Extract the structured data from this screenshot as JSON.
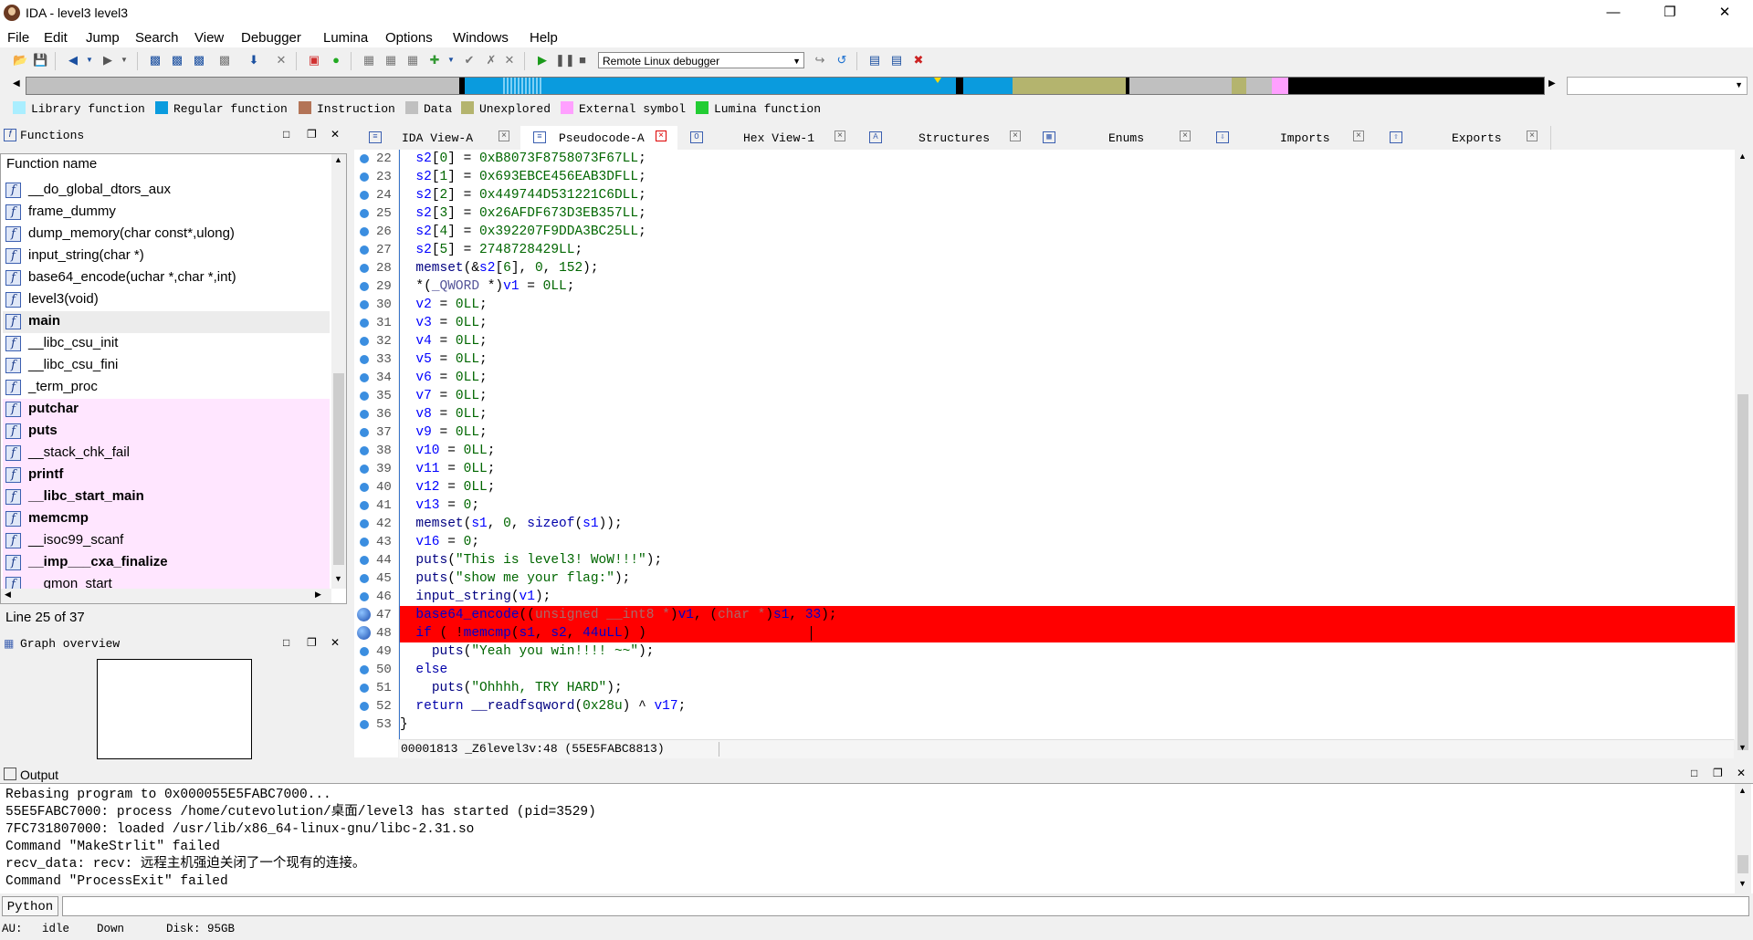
{
  "window": {
    "title": "IDA - level3 level3"
  },
  "menu": [
    "File",
    "Edit",
    "Jump",
    "Search",
    "View",
    "Debugger",
    "Lumina",
    "Options",
    "Windows",
    "Help"
  ],
  "toolbar": {
    "debugger": "Remote Linux debugger"
  },
  "legend": [
    {
      "label": "Library function",
      "color": "#aaeeff"
    },
    {
      "label": "Regular function",
      "color": "#0a9bde"
    },
    {
      "label": "Instruction",
      "color": "#b37457"
    },
    {
      "label": "Data",
      "color": "#c0c0c0"
    },
    {
      "label": "Unexplored",
      "color": "#b4b46e"
    },
    {
      "label": "External symbol",
      "color": "#ffa0ff"
    },
    {
      "label": "Lumina function",
      "color": "#22cc33"
    }
  ],
  "functions_panel": {
    "title": "Functions",
    "column_header": "Function name",
    "items": [
      {
        "name": "__do_global_dtors_aux",
        "bold": false,
        "external": false
      },
      {
        "name": "frame_dummy",
        "bold": false,
        "external": false
      },
      {
        "name": "dump_memory(char const*,ulong)",
        "bold": false,
        "external": false
      },
      {
        "name": "input_string(char *)",
        "bold": false,
        "external": false
      },
      {
        "name": "base64_encode(uchar *,char *,int)",
        "bold": false,
        "external": false
      },
      {
        "name": "level3(void)",
        "bold": false,
        "external": false
      },
      {
        "name": "main",
        "bold": true,
        "external": false
      },
      {
        "name": "__libc_csu_init",
        "bold": false,
        "external": false
      },
      {
        "name": "__libc_csu_fini",
        "bold": false,
        "external": false
      },
      {
        "name": "_term_proc",
        "bold": false,
        "external": false
      },
      {
        "name": "putchar",
        "bold": true,
        "external": true
      },
      {
        "name": "puts",
        "bold": true,
        "external": true
      },
      {
        "name": "__stack_chk_fail",
        "bold": false,
        "external": true
      },
      {
        "name": "printf",
        "bold": true,
        "external": true
      },
      {
        "name": "__libc_start_main",
        "bold": true,
        "external": true
      },
      {
        "name": "memcmp",
        "bold": true,
        "external": true
      },
      {
        "name": "__isoc99_scanf",
        "bold": false,
        "external": true
      },
      {
        "name": "__imp___cxa_finalize",
        "bold": true,
        "external": true
      },
      {
        "name": "__gmon_start__",
        "bold": false,
        "external": true
      }
    ],
    "line_info": "Line 25 of 37"
  },
  "graph_panel": {
    "title": "Graph overview"
  },
  "tabs": [
    {
      "label": "IDA View-A",
      "active": false,
      "icon": "ida-view-icon"
    },
    {
      "label": "Pseudocode-A",
      "active": true,
      "icon": "pseudocode-icon"
    },
    {
      "label": "Hex View-1",
      "active": false,
      "icon": "hex-view-icon"
    },
    {
      "label": "Structures",
      "active": false,
      "icon": "structures-icon"
    },
    {
      "label": "Enums",
      "active": false,
      "icon": "enums-icon"
    },
    {
      "label": "Imports",
      "active": false,
      "icon": "imports-icon"
    },
    {
      "label": "Exports",
      "active": false,
      "icon": "exports-icon"
    }
  ],
  "code": [
    {
      "n": 22,
      "t": [
        [
          "  ",
          ""
        ],
        [
          "s2",
          "v"
        ],
        [
          "[",
          ""
        ],
        [
          "0",
          "n"
        ],
        [
          "] = ",
          ""
        ],
        [
          "0xB8073F8758073F67LL",
          "n"
        ],
        [
          ";",
          ""
        ]
      ]
    },
    {
      "n": 23,
      "t": [
        [
          "  ",
          ""
        ],
        [
          "s2",
          "v"
        ],
        [
          "[",
          ""
        ],
        [
          "1",
          "n"
        ],
        [
          "] = ",
          ""
        ],
        [
          "0x693EBCE456EAB3DFLL",
          "n"
        ],
        [
          ";",
          ""
        ]
      ]
    },
    {
      "n": 24,
      "t": [
        [
          "  ",
          ""
        ],
        [
          "s2",
          "v"
        ],
        [
          "[",
          ""
        ],
        [
          "2",
          "n"
        ],
        [
          "] = ",
          ""
        ],
        [
          "0x449744D531221C6DLL",
          "n"
        ],
        [
          ";",
          ""
        ]
      ]
    },
    {
      "n": 25,
      "t": [
        [
          "  ",
          ""
        ],
        [
          "s2",
          "v"
        ],
        [
          "[",
          ""
        ],
        [
          "3",
          "n"
        ],
        [
          "] = ",
          ""
        ],
        [
          "0x26AFDF673D3EB357LL",
          "n"
        ],
        [
          ";",
          ""
        ]
      ]
    },
    {
      "n": 26,
      "t": [
        [
          "  ",
          ""
        ],
        [
          "s2",
          "v"
        ],
        [
          "[",
          ""
        ],
        [
          "4",
          "n"
        ],
        [
          "] = ",
          ""
        ],
        [
          "0x392207F9DDA3BC25LL",
          "n"
        ],
        [
          ";",
          ""
        ]
      ]
    },
    {
      "n": 27,
      "t": [
        [
          "  ",
          ""
        ],
        [
          "s2",
          "v"
        ],
        [
          "[",
          ""
        ],
        [
          "5",
          "n"
        ],
        [
          "] = ",
          ""
        ],
        [
          "2748728429LL",
          "n"
        ],
        [
          ";",
          ""
        ]
      ]
    },
    {
      "n": 28,
      "t": [
        [
          "  ",
          ""
        ],
        [
          "memset",
          "p"
        ],
        [
          "(&",
          ""
        ],
        [
          "s2",
          "v"
        ],
        [
          "[",
          ""
        ],
        [
          "6",
          "n"
        ],
        [
          "], ",
          ""
        ],
        [
          "0",
          "n"
        ],
        [
          ", ",
          ""
        ],
        [
          "152",
          "n"
        ],
        [
          ");",
          ""
        ]
      ]
    },
    {
      "n": 29,
      "t": [
        [
          "  *(",
          ""
        ],
        [
          "_QWORD",
          "t"
        ],
        [
          " *)",
          ""
        ],
        [
          "v1",
          "v"
        ],
        [
          " = ",
          ""
        ],
        [
          "0LL",
          "n"
        ],
        [
          ";",
          ""
        ]
      ]
    },
    {
      "n": 30,
      "t": [
        [
          "  ",
          ""
        ],
        [
          "v2",
          "v"
        ],
        [
          " = ",
          ""
        ],
        [
          "0LL",
          "n"
        ],
        [
          ";",
          ""
        ]
      ]
    },
    {
      "n": 31,
      "t": [
        [
          "  ",
          ""
        ],
        [
          "v3",
          "v"
        ],
        [
          " = ",
          ""
        ],
        [
          "0LL",
          "n"
        ],
        [
          ";",
          ""
        ]
      ]
    },
    {
      "n": 32,
      "t": [
        [
          "  ",
          ""
        ],
        [
          "v4",
          "v"
        ],
        [
          " = ",
          ""
        ],
        [
          "0LL",
          "n"
        ],
        [
          ";",
          ""
        ]
      ]
    },
    {
      "n": 33,
      "t": [
        [
          "  ",
          ""
        ],
        [
          "v5",
          "v"
        ],
        [
          " = ",
          ""
        ],
        [
          "0LL",
          "n"
        ],
        [
          ";",
          ""
        ]
      ]
    },
    {
      "n": 34,
      "t": [
        [
          "  ",
          ""
        ],
        [
          "v6",
          "v"
        ],
        [
          " = ",
          ""
        ],
        [
          "0LL",
          "n"
        ],
        [
          ";",
          ""
        ]
      ]
    },
    {
      "n": 35,
      "t": [
        [
          "  ",
          ""
        ],
        [
          "v7",
          "v"
        ],
        [
          " = ",
          ""
        ],
        [
          "0LL",
          "n"
        ],
        [
          ";",
          ""
        ]
      ]
    },
    {
      "n": 36,
      "t": [
        [
          "  ",
          ""
        ],
        [
          "v8",
          "v"
        ],
        [
          " = ",
          ""
        ],
        [
          "0LL",
          "n"
        ],
        [
          ";",
          ""
        ]
      ]
    },
    {
      "n": 37,
      "t": [
        [
          "  ",
          ""
        ],
        [
          "v9",
          "v"
        ],
        [
          " = ",
          ""
        ],
        [
          "0LL",
          "n"
        ],
        [
          ";",
          ""
        ]
      ]
    },
    {
      "n": 38,
      "t": [
        [
          "  ",
          ""
        ],
        [
          "v10",
          "v"
        ],
        [
          " = ",
          ""
        ],
        [
          "0LL",
          "n"
        ],
        [
          ";",
          ""
        ]
      ]
    },
    {
      "n": 39,
      "t": [
        [
          "  ",
          ""
        ],
        [
          "v11",
          "v"
        ],
        [
          " = ",
          ""
        ],
        [
          "0LL",
          "n"
        ],
        [
          ";",
          ""
        ]
      ]
    },
    {
      "n": 40,
      "t": [
        [
          "  ",
          ""
        ],
        [
          "v12",
          "v"
        ],
        [
          " = ",
          ""
        ],
        [
          "0LL",
          "n"
        ],
        [
          ";",
          ""
        ]
      ]
    },
    {
      "n": 41,
      "t": [
        [
          "  ",
          ""
        ],
        [
          "v13",
          "v"
        ],
        [
          " = ",
          ""
        ],
        [
          "0",
          "n"
        ],
        [
          ";",
          ""
        ]
      ]
    },
    {
      "n": 42,
      "t": [
        [
          "  ",
          ""
        ],
        [
          "memset",
          "p"
        ],
        [
          "(",
          ""
        ],
        [
          "s1",
          "v"
        ],
        [
          ", ",
          ""
        ],
        [
          "0",
          "n"
        ],
        [
          ", ",
          ""
        ],
        [
          "sizeof",
          "k"
        ],
        [
          "(",
          ""
        ],
        [
          "s1",
          "v"
        ],
        [
          "));",
          ""
        ]
      ]
    },
    {
      "n": 43,
      "t": [
        [
          "  ",
          ""
        ],
        [
          "v16",
          "v"
        ],
        [
          " = ",
          ""
        ],
        [
          "0",
          "n"
        ],
        [
          ";",
          ""
        ]
      ]
    },
    {
      "n": 44,
      "t": [
        [
          "  ",
          ""
        ],
        [
          "puts",
          "p"
        ],
        [
          "(",
          ""
        ],
        [
          "\"This is level3! WoW!!!\"",
          "s"
        ],
        [
          ");",
          ""
        ]
      ]
    },
    {
      "n": 45,
      "t": [
        [
          "  ",
          ""
        ],
        [
          "puts",
          "p"
        ],
        [
          "(",
          ""
        ],
        [
          "\"show me your flag:\"",
          "s"
        ],
        [
          ");",
          ""
        ]
      ]
    },
    {
      "n": 46,
      "t": [
        [
          "  ",
          ""
        ],
        [
          "input_string",
          "p"
        ],
        [
          "(",
          ""
        ],
        [
          "v1",
          "v"
        ],
        [
          ");",
          ""
        ]
      ]
    },
    {
      "n": 47,
      "hl": true,
      "t": [
        [
          "  ",
          ""
        ],
        [
          "base64_encode",
          "p"
        ],
        [
          "((",
          ""
        ],
        [
          "unsigned __int8 *",
          "fadeT"
        ],
        [
          ")",
          ""
        ],
        [
          "v1",
          "v"
        ],
        [
          ", (",
          ""
        ],
        [
          "char *",
          "fadeT"
        ],
        [
          ")",
          ""
        ],
        [
          "s1",
          "v"
        ],
        [
          ", ",
          ""
        ],
        [
          "33",
          "n"
        ],
        [
          ");",
          ""
        ]
      ]
    },
    {
      "n": 48,
      "hl": true,
      "t": [
        [
          "  ",
          ""
        ],
        [
          "if",
          "k"
        ],
        [
          " ( !",
          ""
        ],
        [
          "memcmp",
          "p"
        ],
        [
          "(",
          ""
        ],
        [
          "s1",
          "v"
        ],
        [
          ", ",
          ""
        ],
        [
          "s2",
          "v"
        ],
        [
          ", ",
          ""
        ],
        [
          "44uLL",
          "n"
        ],
        [
          ") )",
          ""
        ]
      ]
    },
    {
      "n": 49,
      "t": [
        [
          "    ",
          ""
        ],
        [
          "puts",
          "p"
        ],
        [
          "(",
          ""
        ],
        [
          "\"Yeah you win!!!! ~~\"",
          "s"
        ],
        [
          ");",
          ""
        ]
      ]
    },
    {
      "n": 50,
      "t": [
        [
          "  ",
          ""
        ],
        [
          "else",
          "k"
        ]
      ]
    },
    {
      "n": 51,
      "t": [
        [
          "    ",
          ""
        ],
        [
          "puts",
          "p"
        ],
        [
          "(",
          ""
        ],
        [
          "\"Ohhhh, TRY HARD\"",
          "s"
        ],
        [
          ");",
          ""
        ]
      ]
    },
    {
      "n": 52,
      "t": [
        [
          "  ",
          ""
        ],
        [
          "return",
          "k"
        ],
        [
          " ",
          ""
        ],
        [
          "__readfsqword",
          "p"
        ],
        [
          "(",
          ""
        ],
        [
          "0x28u",
          "n"
        ],
        [
          ") ^ ",
          ""
        ],
        [
          "v17",
          "v"
        ],
        [
          ";",
          ""
        ]
      ]
    },
    {
      "n": 53,
      "t": [
        [
          "}",
          ""
        ]
      ]
    }
  ],
  "code_status": "00001813 _Z6level3v:48 (55E5FABC8813)",
  "output": {
    "title": "Output",
    "lines": [
      "Rebasing program to 0x000055E5FABC7000...",
      "55E5FABC7000: process /home/cutevolution/桌面/level3 has started (pid=3529)",
      "7FC731807000: loaded /usr/lib/x86_64-linux-gnu/libc-2.31.so",
      "Command \"MakeStrlit\" failed",
      "recv_data: recv: 远程主机强迫关闭了一个现有的连接。",
      "Command \"ProcessExit\" failed"
    ]
  },
  "python_button": "Python",
  "status": {
    "au": "AU:",
    "state": "idle",
    "direction": "Down",
    "disk": "Disk: 95GB"
  }
}
